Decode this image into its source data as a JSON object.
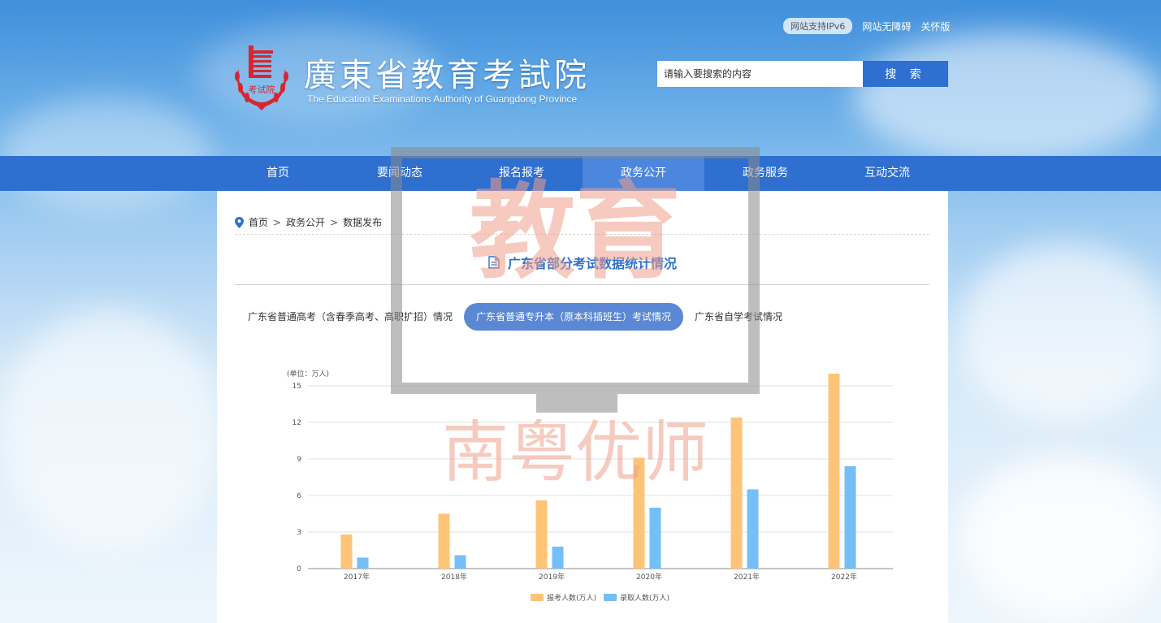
{
  "colors": {
    "nav": "#2f6fd0",
    "nav_active": "#4d86dd",
    "tab_active": "#5b88d4",
    "bar_apply": "#fdc477",
    "bar_admit": "#73bff6",
    "logo_red": "#d8262e"
  },
  "header": {
    "ipv6_badge": "网站支持IPv6",
    "accessibility_link": "网站无障碍",
    "care_link": "关怀版",
    "logo_title": "廣東省教育考試院",
    "logo_subtitle": "The Education Examinations Authority of Guangdong Province",
    "logo_emblem_text": "考试院",
    "search_placeholder": "请输入要搜索的内容",
    "search_button": "搜 索"
  },
  "nav": {
    "items": [
      {
        "label": "首页"
      },
      {
        "label": "要闻动态"
      },
      {
        "label": "报名报考"
      },
      {
        "label": "政务公开"
      },
      {
        "label": "政务服务"
      },
      {
        "label": "互动交流"
      }
    ],
    "active_index": 3
  },
  "breadcrumb": {
    "home": "首页",
    "level1": "政务公开",
    "level2": "数据发布",
    "separator": ">"
  },
  "page": {
    "title": "广东省部分考试数据统计情况"
  },
  "tabs": {
    "items": [
      {
        "label": "广东省普通高考（含春季高考、高职扩招）情况"
      },
      {
        "label": "广东省普通专升本（原本科插班生）考试情况"
      },
      {
        "label": "广东省自学考试情况"
      }
    ],
    "active_index": 1
  },
  "chart_data": {
    "type": "bar",
    "unit_label": "(单位：万人)",
    "categories": [
      "2017年",
      "2018年",
      "2019年",
      "2020年",
      "2021年",
      "2022年"
    ],
    "series": [
      {
        "name": "报考人数(万人)",
        "color": "#fdc477",
        "values": [
          2.8,
          4.5,
          5.6,
          9.1,
          12.4,
          16.0
        ]
      },
      {
        "name": "录取人数(万人)",
        "color": "#73bff6",
        "values": [
          0.9,
          1.1,
          1.8,
          5.0,
          6.5,
          8.4
        ]
      }
    ],
    "ylim": [
      0,
      15
    ],
    "yticks": [
      0,
      3,
      6,
      9,
      12,
      15
    ],
    "grid": true,
    "legend_position": "bottom-center"
  },
  "watermark": {
    "top_text": "教育",
    "bottom_text": "南粤优师"
  }
}
